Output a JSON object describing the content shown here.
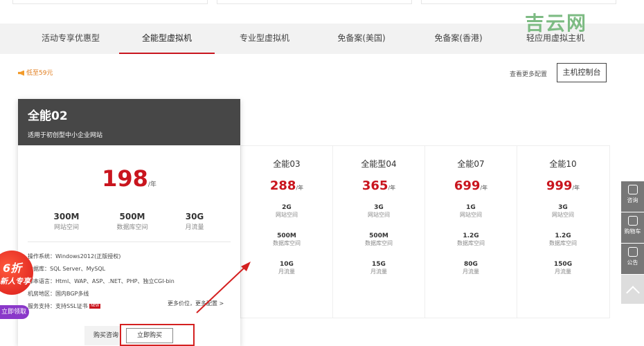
{
  "watermark": "吉云网",
  "tabs": [
    {
      "label": "活动专享优惠型"
    },
    {
      "label": "全能型虚拟机"
    },
    {
      "label": "专业型虚拟机"
    },
    {
      "label": "免备案(美国)"
    },
    {
      "label": "免备案(香港)"
    },
    {
      "label": "轻应用虚拟主机"
    }
  ],
  "promo": "低至59元",
  "more_config": "查看更多配置",
  "console_button": "主机控制台",
  "featured": {
    "name": "全能02",
    "desc": "适用于初创型中小企业网站",
    "price": "198",
    "unit": "/年",
    "specs": [
      {
        "value": "300M",
        "label": "网站空间"
      },
      {
        "value": "500M",
        "label": "数据库空间"
      },
      {
        "value": "30G",
        "label": "月流量"
      }
    ],
    "info": [
      "操作系统：Windows2012(正版授权)",
      "数据库：SQL Server、MySQL",
      "脚本语言：Html、WAP、ASP、.NET、PHP、独立CGI-bin",
      "机房地区：国内BGP多线",
      "服务支持：支持SSL证书"
    ],
    "hot_tag": "NEW",
    "more_price": "更多价位，更多配置 >",
    "consult_button": "购买咨询",
    "buy_button": "立即购买"
  },
  "plans": [
    {
      "name": "全能03",
      "price": "288",
      "unit": "/年",
      "specs": [
        {
          "value": "2G",
          "label": "网站空间"
        },
        {
          "value": "500M",
          "label": "数据库空间"
        },
        {
          "value": "10G",
          "label": "月流量"
        }
      ]
    },
    {
      "name": "全能型04",
      "price": "365",
      "unit": "/年",
      "specs": [
        {
          "value": "3G",
          "label": "网站空间"
        },
        {
          "value": "500M",
          "label": "数据库空间"
        },
        {
          "value": "15G",
          "label": "月流量"
        }
      ]
    },
    {
      "name": "全能07",
      "price": "699",
      "unit": "/年",
      "specs": [
        {
          "value": "1G",
          "label": "网站空间"
        },
        {
          "value": "1.2G",
          "label": "数据库空间"
        },
        {
          "value": "80G",
          "label": "月流量"
        }
      ]
    },
    {
      "name": "全能10",
      "price": "999",
      "unit": "/年",
      "specs": [
        {
          "value": "3G",
          "label": "网站空间"
        },
        {
          "value": "1.2G",
          "label": "数据库空间"
        },
        {
          "value": "150G",
          "label": "月流量"
        }
      ]
    }
  ],
  "sidebar": [
    {
      "label": "咨询",
      "icon": "headset-icon"
    },
    {
      "label": "购物车",
      "icon": "cart-icon"
    },
    {
      "label": "公告",
      "icon": "speaker-icon"
    }
  ],
  "badge": {
    "line1": "6折",
    "line2": "新人专享",
    "tag": "立即领取"
  }
}
